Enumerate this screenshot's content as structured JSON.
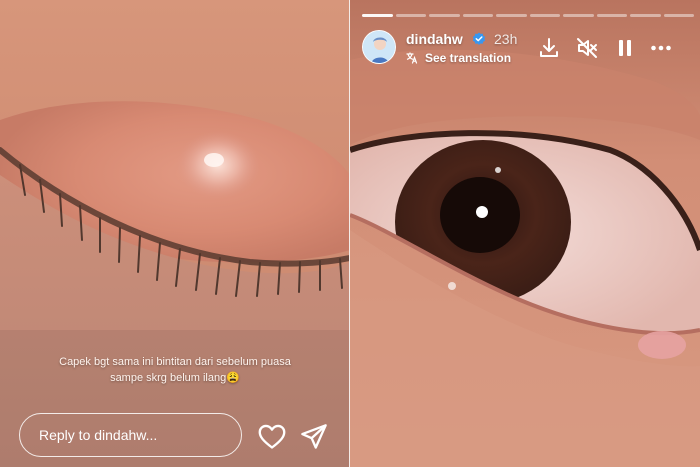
{
  "story_left": {
    "caption_lines": [
      "Capek bgt sama ini bintitan dari sebelum puasa",
      "sampe skrg belum ilang😩"
    ],
    "reply_placeholder": "Reply to dindahw...",
    "icons": {
      "like": "heart-icon",
      "share": "send-icon"
    }
  },
  "story_right": {
    "progress": {
      "segments": 10,
      "active": 1
    },
    "username": "dindahw",
    "timestamp": "23h",
    "see_translation": "See translation",
    "icons": {
      "verified": "verified-badge-icon",
      "translate": "translate-icon",
      "download": "download-icon",
      "mute": "muted-speaker-icon",
      "pause": "pause-icon",
      "more": "more-options-icon"
    }
  },
  "colors": {
    "overlay_text": "#ffffff",
    "verified_blue": "#3897f0",
    "skin": "#d89a80"
  }
}
